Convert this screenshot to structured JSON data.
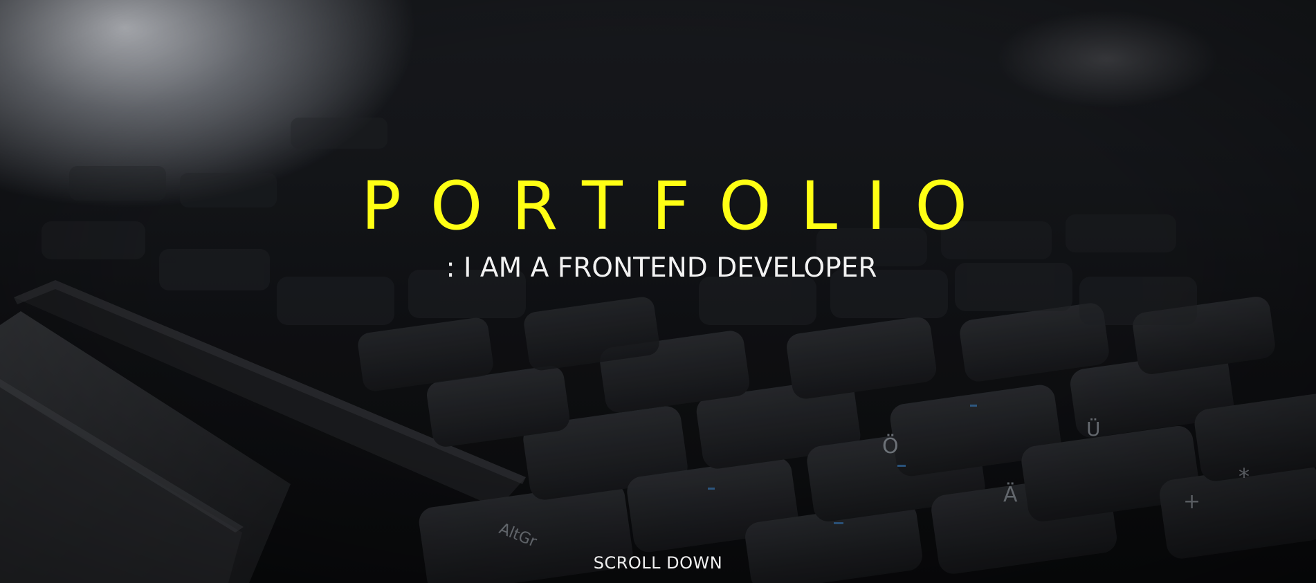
{
  "hero": {
    "title": "PORTFOLIO",
    "subtitle": ": I AM A FRONTEND DEVELOPER",
    "scroll_label": "SCROLL DOWN",
    "background_image": "laptop-keyboard-photo"
  },
  "colors": {
    "title": "#ffff14",
    "subtitle": "#f2f2f2",
    "background": "#101114"
  }
}
